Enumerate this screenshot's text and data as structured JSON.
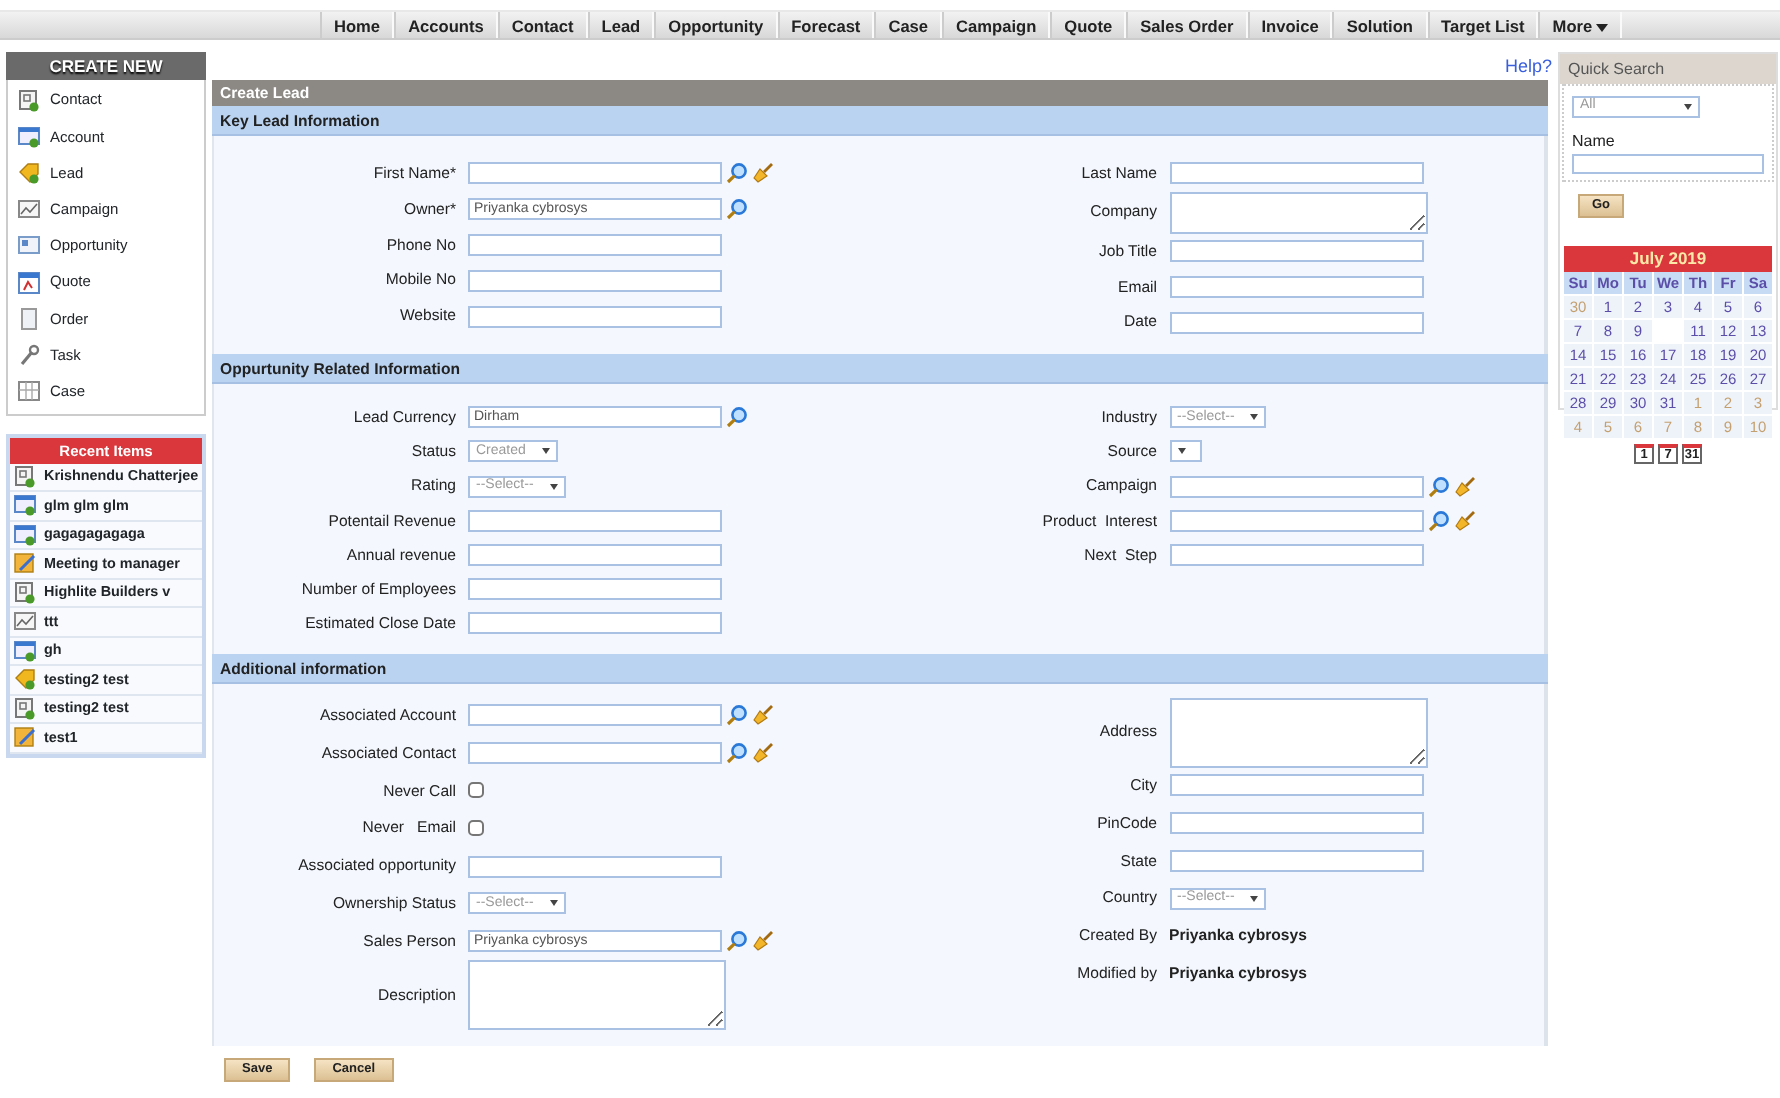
{
  "nav": {
    "items": [
      {
        "label": "Home"
      },
      {
        "label": "Accounts"
      },
      {
        "label": "Contact"
      },
      {
        "label": "Lead"
      },
      {
        "label": "Opportunity"
      },
      {
        "label": "Forecast"
      },
      {
        "label": "Case"
      },
      {
        "label": "Campaign"
      },
      {
        "label": "Quote"
      },
      {
        "label": "Sales Order"
      },
      {
        "label": "Invoice"
      },
      {
        "label": "Solution"
      },
      {
        "label": "Target List"
      },
      {
        "label": "More",
        "dropdown": true
      }
    ]
  },
  "create_new": {
    "title": "CREATE NEW",
    "items": [
      {
        "label": "Contact",
        "kind": "contact"
      },
      {
        "label": "Account",
        "kind": "account"
      },
      {
        "label": "Lead",
        "kind": "lead"
      },
      {
        "label": "Campaign",
        "kind": "campaign"
      },
      {
        "label": "Opportunity",
        "kind": "opportunity"
      },
      {
        "label": "Quote",
        "kind": "quote"
      },
      {
        "label": "Order",
        "kind": "order"
      },
      {
        "label": "Task",
        "kind": "task"
      },
      {
        "label": "Case",
        "kind": "case"
      }
    ]
  },
  "recent_items": {
    "title": "Recent Items",
    "items": [
      {
        "label": "Krishnendu Chatterjee",
        "kind": "contact"
      },
      {
        "label": "glm glm glm",
        "kind": "account"
      },
      {
        "label": "gagagagagaga",
        "kind": "account"
      },
      {
        "label": "Meeting to manager",
        "kind": "meeting"
      },
      {
        "label": "Highlite Builders v",
        "kind": "contact"
      },
      {
        "label": "ttt",
        "kind": "campaign"
      },
      {
        "label": "gh",
        "kind": "account"
      },
      {
        "label": "testing2 test",
        "kind": "lead"
      },
      {
        "label": "testing2 test",
        "kind": "contact"
      },
      {
        "label": "test1",
        "kind": "meeting"
      }
    ]
  },
  "help_link": "Help?",
  "form": {
    "title": "Create Lead",
    "sections": [
      {
        "title": "Key Lead Information",
        "left": [
          {
            "label": "First Name*",
            "kind": "text",
            "lookup": true,
            "clear": true
          },
          {
            "label": "Owner*",
            "kind": "text",
            "value": "Priyanka cybrosys",
            "lookup": true
          },
          {
            "label": "Phone No",
            "kind": "text"
          },
          {
            "label": "Mobile No",
            "kind": "text"
          },
          {
            "label": "Website",
            "kind": "text"
          }
        ],
        "right": [
          {
            "label": "Last Name",
            "kind": "text"
          },
          {
            "label": "Company",
            "kind": "textarea"
          },
          {
            "label": "Job Title",
            "kind": "text"
          },
          {
            "label": "Email",
            "kind": "text"
          },
          {
            "label": "Date",
            "kind": "text"
          }
        ]
      },
      {
        "title": "Oppurtunity  Related  Information",
        "left": [
          {
            "label": "Lead Currency",
            "kind": "text",
            "value": "Dirham",
            "lookup": true
          },
          {
            "label": "Status",
            "kind": "select",
            "value": "Created"
          },
          {
            "label": "Rating",
            "kind": "select",
            "value": "--Select--"
          },
          {
            "label": "Potentail Revenue",
            "kind": "text"
          },
          {
            "label": "Annual revenue",
            "kind": "text"
          },
          {
            "label": "Number of Employees",
            "kind": "text"
          },
          {
            "label": "Estimated Close Date",
            "kind": "text"
          }
        ],
        "right": [
          {
            "label": "Industry",
            "kind": "select",
            "value": "--Select--"
          },
          {
            "label": "Source",
            "kind": "select"
          },
          {
            "label": "Campaign",
            "kind": "text",
            "lookup": true,
            "clear": true
          },
          {
            "label": "Product  Interest",
            "kind": "text",
            "lookup": true,
            "clear": true
          },
          {
            "label": "Next  Step",
            "kind": "text"
          }
        ]
      },
      {
        "title": "Additional information",
        "left": [
          {
            "label": "Associated Account",
            "kind": "text",
            "lookup": true,
            "clear": true
          },
          {
            "label": "Associated Contact",
            "kind": "text",
            "lookup": true,
            "clear": true
          },
          {
            "label": "Never Call",
            "kind": "checkbox",
            "checked": false
          },
          {
            "label": "Never   Email",
            "kind": "checkbox",
            "checked": false
          },
          {
            "label": "Associated opportunity",
            "kind": "text"
          },
          {
            "label": "Ownership Status",
            "kind": "select",
            "value": "--Select--"
          },
          {
            "label": "Sales Person",
            "kind": "text",
            "value": "Priyanka cybrosys",
            "lookup": true,
            "clear": true
          },
          {
            "label": "Description",
            "kind": "textarea"
          }
        ],
        "right": [
          {
            "label": "Address",
            "kind": "textarea"
          },
          {
            "label": "City",
            "kind": "text"
          },
          {
            "label": "PinCode",
            "kind": "text"
          },
          {
            "label": "State",
            "kind": "text"
          },
          {
            "label": "Country",
            "kind": "select",
            "value": "--Select--"
          },
          {
            "label": "Created By",
            "kind": "static",
            "value": "Priyanka cybrosys"
          },
          {
            "label": "Modified by",
            "kind": "static",
            "value": "Priyanka cybrosys"
          }
        ]
      }
    ],
    "buttons": [
      "Save",
      "Cancel"
    ]
  },
  "quick_search": {
    "title": "Quick Search",
    "filter": "All",
    "name_label": "Name",
    "button": "Go"
  },
  "calendar": {
    "title": "July 2019",
    "weekdays": [
      "Su",
      "Mo",
      "Tu",
      "We",
      "Th",
      "Fr",
      "Sa"
    ],
    "weeks": [
      [
        {
          "kind": "day",
          "day": "30",
          "outside": true
        },
        {
          "kind": "day",
          "day": "1",
          "outside": false
        },
        {
          "kind": "day",
          "day": "2",
          "outside": false
        },
        {
          "kind": "day",
          "day": "3",
          "outside": false
        },
        {
          "kind": "day",
          "day": "4",
          "outside": false
        },
        {
          "kind": "day",
          "day": "5",
          "outside": false
        },
        {
          "kind": "day",
          "day": "6",
          "outside": false
        }
      ],
      [
        {
          "kind": "day",
          "day": "7",
          "outside": false
        },
        {
          "kind": "day",
          "day": "8",
          "outside": false
        },
        {
          "kind": "day",
          "day": "9",
          "outside": false
        },
        {
          "kind": "blank"
        },
        {
          "kind": "day",
          "day": "11",
          "outside": false
        },
        {
          "kind": "day",
          "day": "12",
          "outside": false
        },
        {
          "kind": "day",
          "day": "13",
          "outside": false
        }
      ],
      [
        {
          "kind": "day",
          "day": "14",
          "outside": false
        },
        {
          "kind": "day",
          "day": "15",
          "outside": false
        },
        {
          "kind": "day",
          "day": "16",
          "outside": false
        },
        {
          "kind": "day",
          "day": "17",
          "outside": false
        },
        {
          "kind": "day",
          "day": "18",
          "outside": false
        },
        {
          "kind": "day",
          "day": "19",
          "outside": false
        },
        {
          "kind": "day",
          "day": "20",
          "outside": false
        }
      ],
      [
        {
          "kind": "day",
          "day": "21",
          "outside": false
        },
        {
          "kind": "day",
          "day": "22",
          "outside": false
        },
        {
          "kind": "day",
          "day": "23",
          "outside": false
        },
        {
          "kind": "day",
          "day": "24",
          "outside": false
        },
        {
          "kind": "day",
          "day": "25",
          "outside": false
        },
        {
          "kind": "day",
          "day": "26",
          "outside": false
        },
        {
          "kind": "day",
          "day": "27",
          "outside": false
        }
      ],
      [
        {
          "kind": "day",
          "day": "28",
          "outside": false
        },
        {
          "kind": "day",
          "day": "29",
          "outside": false
        },
        {
          "kind": "day",
          "day": "30",
          "outside": false
        },
        {
          "kind": "day",
          "day": "31",
          "outside": false
        },
        {
          "kind": "day",
          "day": "1",
          "outside": true
        },
        {
          "kind": "day",
          "day": "2",
          "outside": true
        },
        {
          "kind": "day",
          "day": "3",
          "outside": true
        }
      ],
      [
        {
          "kind": "day",
          "day": "4",
          "outside": true
        },
        {
          "kind": "day",
          "day": "5",
          "outside": true
        },
        {
          "kind": "day",
          "day": "6",
          "outside": true
        },
        {
          "kind": "day",
          "day": "7",
          "outside": true
        },
        {
          "kind": "day",
          "day": "8",
          "outside": true
        },
        {
          "kind": "day",
          "day": "9",
          "outside": true
        },
        {
          "kind": "day",
          "day": "10",
          "outside": true
        }
      ]
    ],
    "views": [
      "1",
      "7",
      "31"
    ]
  }
}
